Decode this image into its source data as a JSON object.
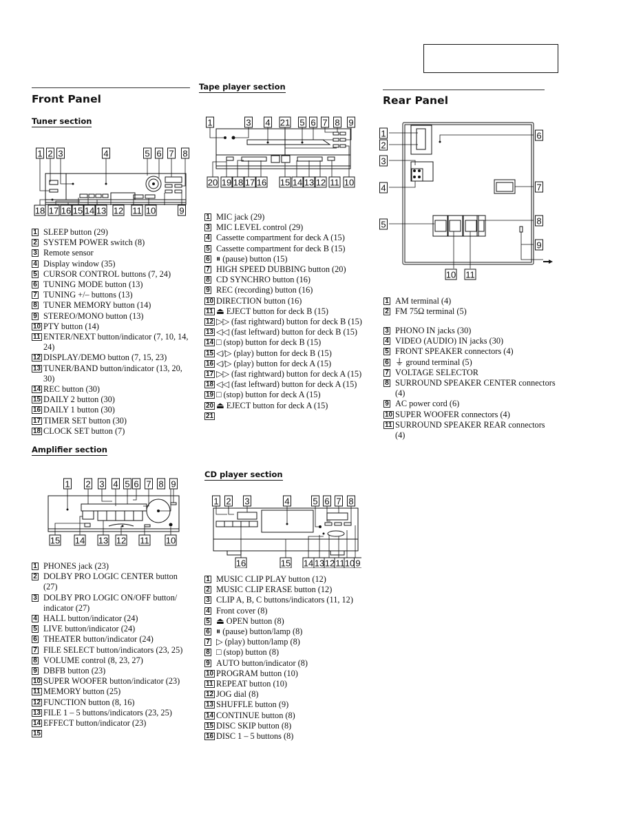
{
  "front_panel": {
    "title": "Front Panel",
    "tuner": {
      "heading": "Tuner section",
      "callouts_top": [
        "1",
        "2",
        "3",
        "4",
        "5",
        "6",
        "7",
        "8"
      ],
      "callouts_bottom": [
        "18",
        "17",
        "16",
        "15",
        "14",
        "13",
        "12",
        "11",
        "10",
        "9"
      ],
      "items": [
        {
          "n": "1",
          "text": "SLEEP button (29)"
        },
        {
          "n": "2",
          "text": "SYSTEM POWER switch (8)"
        },
        {
          "n": "3",
          "text": "Remote sensor"
        },
        {
          "n": "4",
          "text": "Display window (35)"
        },
        {
          "n": "5",
          "text": "CURSOR CONTROL buttons (7, 24)"
        },
        {
          "n": "6",
          "text": "TUNING MODE button (13)"
        },
        {
          "n": "7",
          "text": "TUNING +/– buttons (13)"
        },
        {
          "n": "8",
          "text": "TUNER MEMORY button (14)"
        },
        {
          "n": "9",
          "text": "STEREO/MONO button (13)"
        },
        {
          "n": "10",
          "text": "PTY button (14)"
        },
        {
          "n": "11",
          "text": "ENTER/NEXT button/indicator (7, 10, 14, 24)"
        },
        {
          "n": "12",
          "text": "DISPLAY/DEMO button (7, 15, 23)"
        },
        {
          "n": "13",
          "text": "TUNER/BAND button/indicator (13, 20, 30)"
        },
        {
          "n": "14",
          "text": "REC button (30)"
        },
        {
          "n": "15",
          "text": "DAILY 2 button (30)"
        },
        {
          "n": "16",
          "text": "DAILY 1 button (30)"
        },
        {
          "n": "17",
          "text": "TIMER SET button (30)"
        },
        {
          "n": "18",
          "text": "CLOCK SET button (7)"
        }
      ]
    },
    "amplifier": {
      "heading": "Amplifier section",
      "callouts_top": [
        "1",
        "2",
        "3",
        "4",
        "5",
        "6",
        "7",
        "8",
        "9"
      ],
      "callouts_bottom": [
        "15",
        "14",
        "13",
        "12",
        "11",
        "10"
      ],
      "items": [
        {
          "n": "1",
          "text": "PHONES jack (23)"
        },
        {
          "n": "2",
          "text": "DOLBY PRO LOGIC CENTER button (27)"
        },
        {
          "n": "3",
          "text": "DOLBY PRO LOGIC ON/OFF button/ indicator (27)"
        },
        {
          "n": "4",
          "text": "HALL button/indicator (24)"
        },
        {
          "n": "5",
          "text": "LIVE button/indicator (24)"
        },
        {
          "n": "6",
          "text": "THEATER button/indicator (24)"
        },
        {
          "n": "7",
          "text": "FILE SELECT button/indicators (23, 25)"
        },
        {
          "n": "8",
          "text": "VOLUME control (8, 23, 27)"
        },
        {
          "n": "9",
          "text": "DBFB button (23)"
        },
        {
          "n": "10",
          "text": "SUPER WOOFER button/indicator (23)"
        },
        {
          "n": "11",
          "text": "MEMORY button (25)"
        },
        {
          "n": "12",
          "text": "FUNCTION button (8, 16)"
        },
        {
          "n": "13",
          "text": "FILE 1 – 5 buttons/indicators (23, 25)"
        },
        {
          "n": "14",
          "text": "EFFECT button/indicator (23)"
        },
        {
          "n": "15",
          "text": ""
        }
      ]
    }
  },
  "tape": {
    "heading": "Tape player section",
    "callouts_top": [
      "1",
      "3",
      "4",
      "21",
      "5",
      "6",
      "7",
      "8",
      "9"
    ],
    "callouts_bottom": [
      "20",
      "19",
      "18",
      "17",
      "16",
      "15",
      "14",
      "13",
      "12",
      "11",
      "10"
    ],
    "items": [
      {
        "n": "1",
        "text": "MIC jack (29)"
      },
      {
        "n": "3",
        "text": "MIC LEVEL control (29)"
      },
      {
        "n": "4",
        "text": "Cassette compartment for deck A (15)"
      },
      {
        "n": "5",
        "text": "Cassette compartment for deck B (15)"
      },
      {
        "n": "6",
        "text": "⏸ (pause) button (15)"
      },
      {
        "n": "7",
        "text": "HIGH SPEED DUBBING button (20)"
      },
      {
        "n": "8",
        "text": "CD SYNCHRO button (16)"
      },
      {
        "n": "9",
        "text": "REC (recording) button (16)"
      },
      {
        "n": "10",
        "text": "DIRECTION button (16)"
      },
      {
        "n": "11",
        "text": "⏏ EJECT button for deck B (15)"
      },
      {
        "n": "12",
        "text": "▷▷ (fast rightward) button for deck B (15)"
      },
      {
        "n": "13",
        "text": "◁◁ (fast leftward) button for deck B (15)"
      },
      {
        "n": "14",
        "text": "□ (stop) button for deck B (15)"
      },
      {
        "n": "15",
        "text": "◁/▷ (play) button for deck B (15)"
      },
      {
        "n": "16",
        "text": "◁/▷ (play) button for deck A (15)"
      },
      {
        "n": "17",
        "text": "▷▷ (fast rightward) button for deck A (15)"
      },
      {
        "n": "18",
        "text": "◁◁ (fast leftward) button for deck A (15)"
      },
      {
        "n": "19",
        "text": "□ (stop) button for deck A (15)"
      },
      {
        "n": "20",
        "text": "⏏ EJECT button for deck A (15)"
      },
      {
        "n": "21",
        "text": ""
      }
    ]
  },
  "cd": {
    "heading": "CD player section",
    "callouts_top": [
      "1",
      "2",
      "3",
      "4",
      "5",
      "6",
      "7",
      "8"
    ],
    "callouts_bottom": [
      "16",
      "15",
      "14",
      "13",
      "12",
      "11",
      "10",
      "9"
    ],
    "items": [
      {
        "n": "1",
        "text": "MUSIC CLIP PLAY button (12)"
      },
      {
        "n": "2",
        "text": "MUSIC CLIP ERASE button (12)"
      },
      {
        "n": "3",
        "text": "CLIP A, B, C buttons/indicators (11, 12)"
      },
      {
        "n": "4",
        "text": "Front cover (8)"
      },
      {
        "n": "5",
        "text": "⏏ OPEN button (8)"
      },
      {
        "n": "6",
        "text": "⏸ (pause) button/lamp (8)"
      },
      {
        "n": "7",
        "text": "▷ (play) button/lamp (8)"
      },
      {
        "n": "8",
        "text": "□ (stop) button (8)"
      },
      {
        "n": "9",
        "text": "AUTO button/indicator (8)"
      },
      {
        "n": "10",
        "text": "PROGRAM button (10)"
      },
      {
        "n": "11",
        "text": "REPEAT button (10)"
      },
      {
        "n": "12",
        "text": "JOG dial (8)"
      },
      {
        "n": "13",
        "text": "SHUFFLE button (9)"
      },
      {
        "n": "14",
        "text": "CONTINUE button (8)"
      },
      {
        "n": "15",
        "text": "DISC SKIP button (8)"
      },
      {
        "n": "16",
        "text": "DISC 1 – 5 buttons (8)"
      }
    ]
  },
  "rear_panel": {
    "title": "Rear Panel",
    "callouts_left": [
      "1",
      "2",
      "3",
      "4",
      "5"
    ],
    "callouts_right": [
      "6",
      "7",
      "8",
      "9"
    ],
    "callouts_bottom": [
      "10",
      "11"
    ],
    "items_group1": [
      {
        "n": "1",
        "text": "AM terminal (4)"
      },
      {
        "n": "2",
        "text": "FM 75Ω terminal (5)"
      }
    ],
    "items_group2": [
      {
        "n": "3",
        "text": "PHONO IN jacks (30)"
      },
      {
        "n": "4",
        "text": "VIDEO (AUDIO) IN jacks (30)"
      },
      {
        "n": "5",
        "text": "FRONT SPEAKER connectors (4)"
      },
      {
        "n": "6",
        "text": "⏚ ground terminal (5)"
      },
      {
        "n": "7",
        "text": "VOLTAGE SELECTOR"
      },
      {
        "n": "8",
        "text": "SURROUND SPEAKER CENTER connectors (4)"
      },
      {
        "n": "9",
        "text": "AC power cord (6)"
      },
      {
        "n": "10",
        "text": "SUPER WOOFER connectors (4)"
      },
      {
        "n": "11",
        "text": "SURROUND SPEAKER REAR connectors (4)"
      }
    ]
  }
}
